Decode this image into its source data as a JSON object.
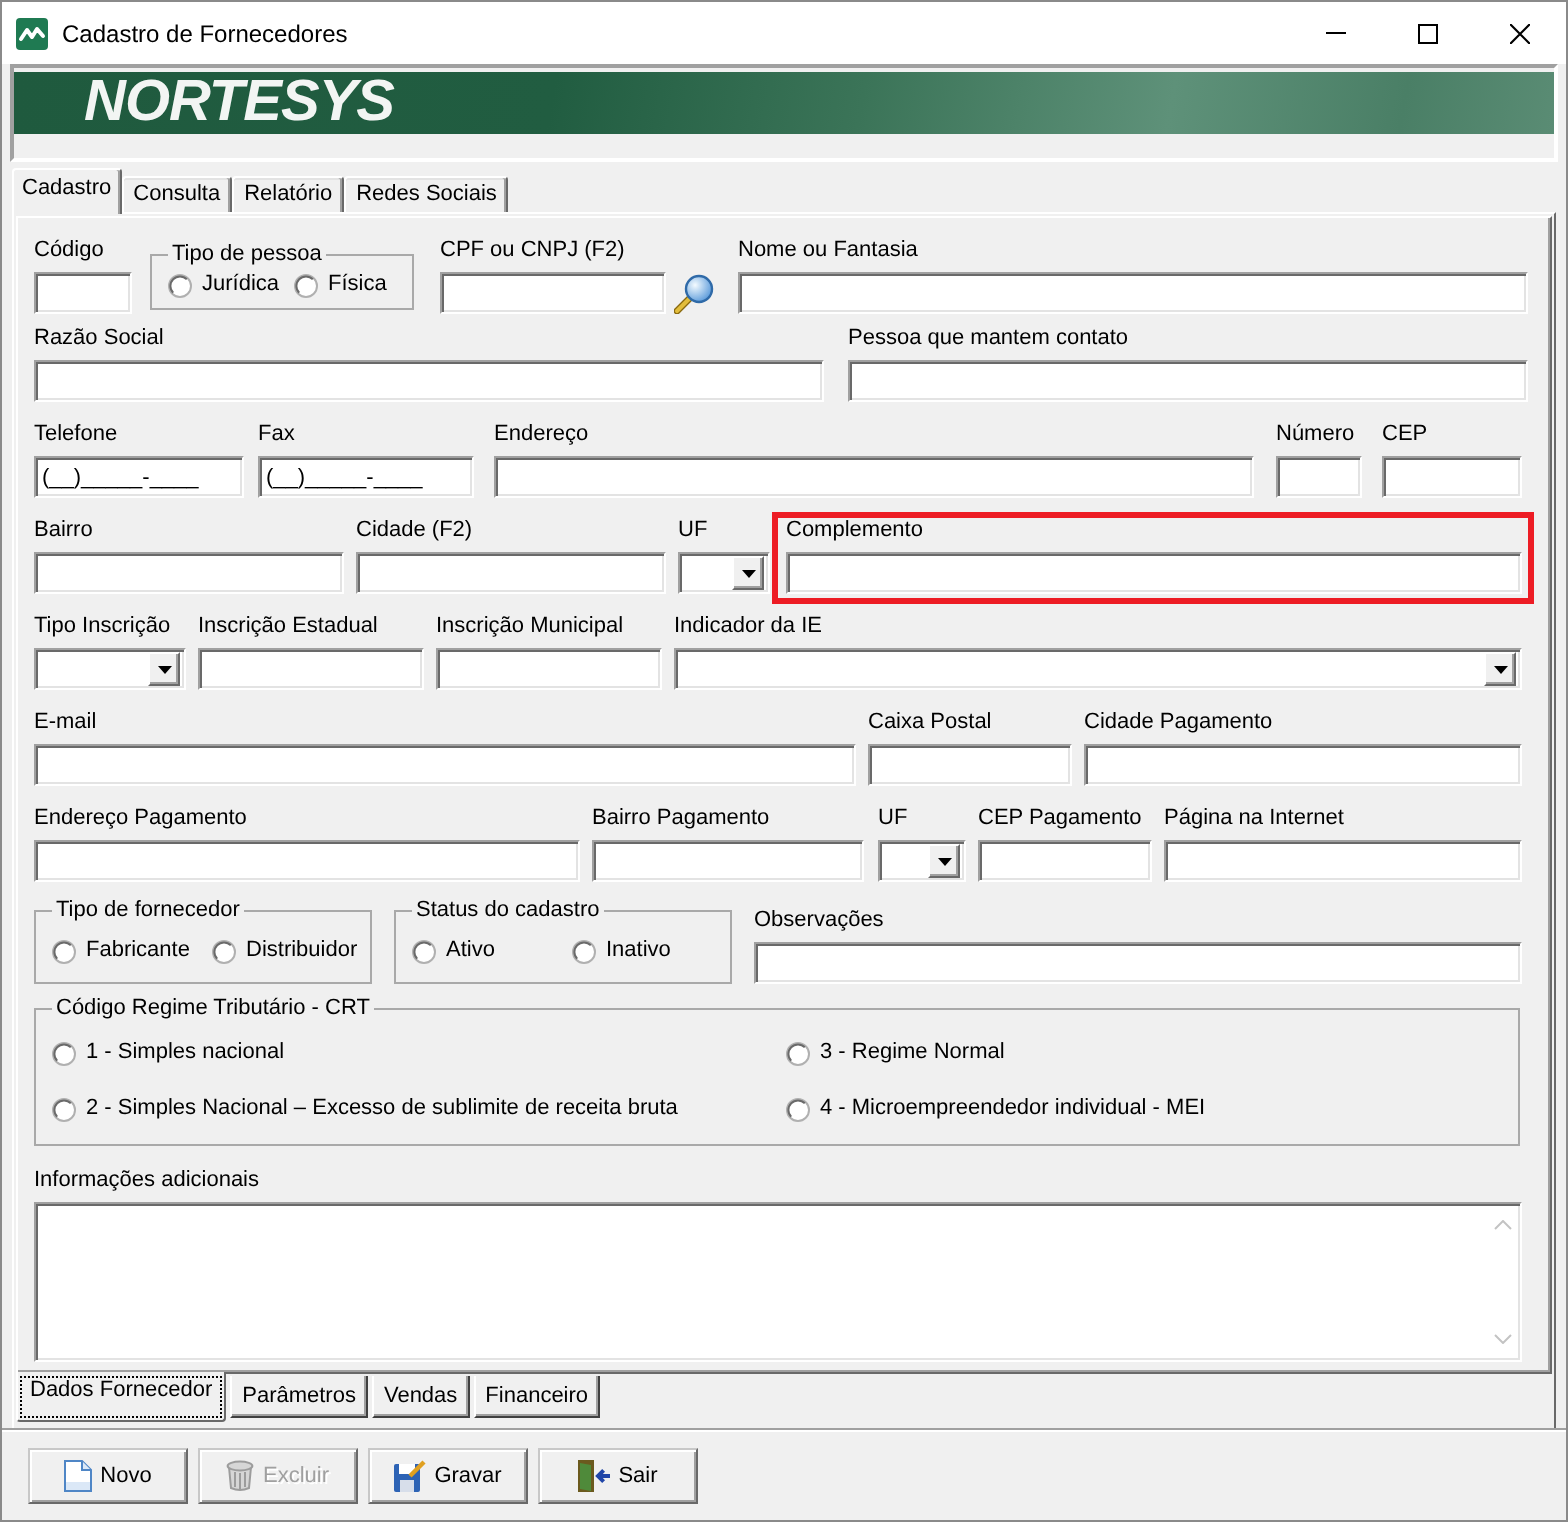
{
  "window": {
    "title": "Cadastro de Fornecedores"
  },
  "banner": {
    "logo": "NORTESYS"
  },
  "tabs": [
    {
      "label": "Cadastro",
      "selected": true
    },
    {
      "label": "Consulta",
      "selected": false
    },
    {
      "label": "Relatório",
      "selected": false
    },
    {
      "label": "Redes Sociais",
      "selected": false
    }
  ],
  "form": {
    "fields": [
      {
        "kind": "text",
        "label": "Código",
        "highlighted": false
      },
      {
        "kind": "radio_group",
        "title": "Tipo de pessoa",
        "highlighted": false,
        "options": [
          {
            "label": "Jurídica",
            "selected": false
          },
          {
            "label": "Física",
            "selected": false
          }
        ]
      },
      {
        "kind": "lookup",
        "label": "CPF ou CNPJ (F2)",
        "highlighted": false
      },
      {
        "kind": "text",
        "label": "Nome ou Fantasia",
        "highlighted": false
      },
      {
        "kind": "text",
        "label": "Razão Social",
        "highlighted": false
      },
      {
        "kind": "text",
        "label": "Pessoa que mantem contato",
        "highlighted": false
      },
      {
        "kind": "text",
        "label": "Telefone",
        "value": "(__)_____-____",
        "highlighted": false
      },
      {
        "kind": "text",
        "label": "Fax",
        "value": "(__)_____-____",
        "highlighted": false
      },
      {
        "kind": "text",
        "label": "Endereço",
        "highlighted": false
      },
      {
        "kind": "text",
        "label": "Número",
        "highlighted": false
      },
      {
        "kind": "text",
        "label": "CEP",
        "highlighted": false
      },
      {
        "kind": "text",
        "label": "Bairro",
        "highlighted": false
      },
      {
        "kind": "text",
        "label": "Cidade (F2)",
        "highlighted": false
      },
      {
        "kind": "combo",
        "label": "UF",
        "highlighted": false
      },
      {
        "kind": "text",
        "label": "Complemento",
        "highlighted": true
      },
      {
        "kind": "combo",
        "label": "Tipo Inscrição",
        "highlighted": false
      },
      {
        "kind": "text",
        "label": "Inscrição Estadual",
        "highlighted": false
      },
      {
        "kind": "text",
        "label": "Inscrição Municipal",
        "highlighted": false
      },
      {
        "kind": "combo",
        "label": "Indicador da IE",
        "highlighted": false
      },
      {
        "kind": "text",
        "label": "E-mail",
        "highlighted": false
      },
      {
        "kind": "text",
        "label": "Caixa Postal",
        "highlighted": false
      },
      {
        "kind": "text",
        "label": "Cidade Pagamento",
        "highlighted": false
      },
      {
        "kind": "text",
        "label": "Endereço Pagamento",
        "highlighted": false
      },
      {
        "kind": "text",
        "label": "Bairro Pagamento",
        "highlighted": false
      },
      {
        "kind": "combo",
        "label": "UF",
        "highlighted": false
      },
      {
        "kind": "text",
        "label": "CEP Pagamento",
        "highlighted": false
      },
      {
        "kind": "text",
        "label": "Página na Internet",
        "highlighted": false
      },
      {
        "kind": "radio_group",
        "title": "Tipo de fornecedor",
        "highlighted": false,
        "options": [
          {
            "label": "Fabricante",
            "selected": false
          },
          {
            "label": "Distribuidor",
            "selected": false
          }
        ]
      },
      {
        "kind": "radio_group",
        "title": "Status do cadastro",
        "highlighted": false,
        "options": [
          {
            "label": "Ativo",
            "selected": false
          },
          {
            "label": "Inativo",
            "selected": false
          }
        ]
      },
      {
        "kind": "text",
        "label": "Observações",
        "highlighted": false
      },
      {
        "kind": "radio_group",
        "title": "Código Regime Tributário - CRT",
        "highlighted": false,
        "options": [
          {
            "label": "1 - Simples nacional",
            "selected": false
          },
          {
            "label": "2 - Simples Nacional – Excesso de sublimite de receita bruta",
            "selected": false
          },
          {
            "label": "3 - Regime Normal",
            "selected": false
          },
          {
            "label": "4 - Microempreendedor individual - MEI",
            "selected": false
          }
        ]
      },
      {
        "kind": "memo",
        "label": "Informações adicionais",
        "highlighted": false
      }
    ]
  },
  "bottom_tabs": [
    {
      "label": "Dados Fornecedor",
      "selected": true
    },
    {
      "label": "Parâmetros",
      "selected": false
    },
    {
      "label": "Vendas",
      "selected": false
    },
    {
      "label": "Financeiro",
      "selected": false
    }
  ],
  "buttons": [
    {
      "label": "Novo",
      "disabled": false
    },
    {
      "label": "Excluir",
      "disabled": true
    },
    {
      "label": "Gravar",
      "disabled": false
    },
    {
      "label": "Sair",
      "disabled": false
    }
  ]
}
